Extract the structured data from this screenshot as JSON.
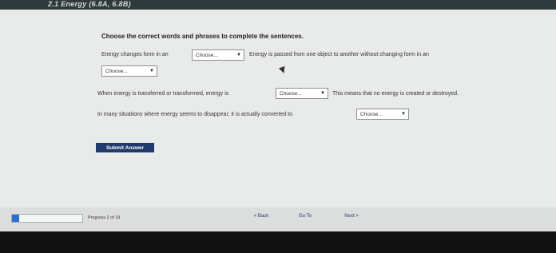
{
  "header": {
    "title": "2.1 Energy (6.8A, 6.8B)"
  },
  "question": {
    "instructions": "Choose the correct words and phrases to complete the sentences.",
    "sentence1_part1": "Energy changes form in an",
    "select1": "Choose...",
    "sentence1_part2": "Energy is passed from one object to another without changing form in an",
    "select2": "Choose...",
    "sentence2_part1": "When energy is transferred or transformed, energy is",
    "select3": "Choose...",
    "sentence2_part2": "This means that no energy is created or destroyed.",
    "sentence3_part1": "In many situations where energy seems to disappear, it is actually converted to",
    "select4": "Choose..."
  },
  "submit_label": "Submit Answer",
  "footer": {
    "progress_label": "Progress 2 of 19",
    "progress_fraction": 0.105,
    "back_label": "< Back",
    "goto_label": "Go To",
    "next_label": "Next >"
  },
  "icons": {
    "dropdown": "chevron-down-icon"
  }
}
